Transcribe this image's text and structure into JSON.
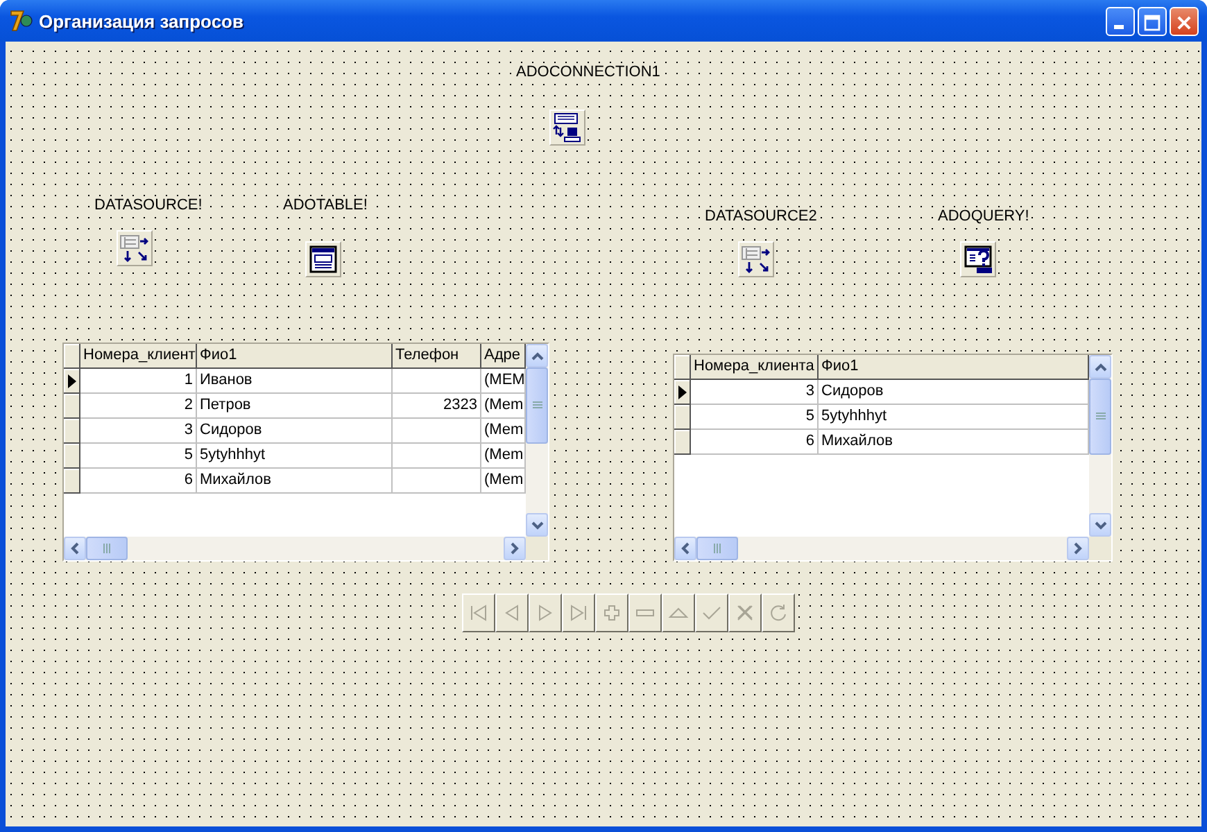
{
  "window": {
    "title": "Организация запросов"
  },
  "components": [
    {
      "kind": "connection",
      "label": "ADOCONNECTION1"
    },
    {
      "kind": "datasource",
      "label": "DATASOURCE!"
    },
    {
      "kind": "table",
      "label": "ADOTABLE!"
    },
    {
      "kind": "datasource",
      "label": "DATASOURCE2"
    },
    {
      "kind": "query",
      "label": "ADOQUERY!"
    }
  ],
  "grids": [
    {
      "columns": [
        {
          "title": "Номера_клиент",
          "kind": "number"
        },
        {
          "title": "Фио1",
          "kind": "text"
        },
        {
          "title": "Телефон",
          "kind": "number"
        },
        {
          "title": "Адре",
          "kind": "text"
        }
      ],
      "rows": [
        {
          "selected": true,
          "cells": [
            "1",
            "Иванов",
            null,
            "(MEM"
          ]
        },
        {
          "selected": false,
          "cells": [
            "2",
            "Петров",
            "2323",
            "(Mem"
          ]
        },
        {
          "selected": false,
          "cells": [
            "3",
            "Сидоров",
            null,
            "(Mem"
          ]
        },
        {
          "selected": false,
          "cells": [
            "5",
            "5ytyhhhyt",
            null,
            "(Mem"
          ]
        },
        {
          "selected": false,
          "cells": [
            "6",
            "Михайлов",
            null,
            "(Mem"
          ]
        }
      ]
    },
    {
      "columns": [
        {
          "title": "Номера_клиента",
          "kind": "number"
        },
        {
          "title": "Фио1",
          "kind": "text"
        }
      ],
      "rows": [
        {
          "selected": true,
          "cells": [
            "3",
            "Сидоров"
          ]
        },
        {
          "selected": false,
          "cells": [
            "5",
            "5ytyhhhyt"
          ]
        },
        {
          "selected": false,
          "cells": [
            "6",
            "Михайлов"
          ]
        }
      ]
    }
  ],
  "navigator": [
    {
      "kind": "first",
      "disabled": true
    },
    {
      "kind": "prior",
      "disabled": true
    },
    {
      "kind": "next",
      "disabled": true
    },
    {
      "kind": "last",
      "disabled": true
    },
    {
      "kind": "insert",
      "disabled": true
    },
    {
      "kind": "delete",
      "disabled": true
    },
    {
      "kind": "edit",
      "disabled": true
    },
    {
      "kind": "post",
      "disabled": true
    },
    {
      "kind": "cancel",
      "disabled": true
    },
    {
      "kind": "refresh",
      "disabled": true
    }
  ]
}
